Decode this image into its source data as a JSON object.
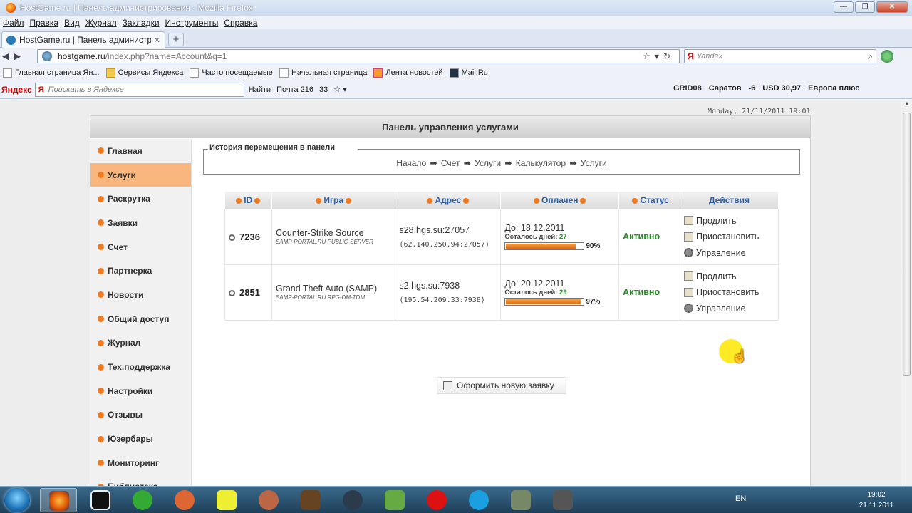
{
  "window": {
    "title": "HostGame.ru | Панель администрирования - Mozilla Firefox"
  },
  "menu": [
    "Файл",
    "Правка",
    "Вид",
    "Журнал",
    "Закладки",
    "Инструменты",
    "Справка"
  ],
  "tab": {
    "label": "HostGame.ru | Панель администров..."
  },
  "address": {
    "host": "hostgame.ru",
    "path": "/index.php?name=Account&q=1"
  },
  "search": {
    "placeholder": "Yandex"
  },
  "bookmarks": [
    "Главная страница Ян...",
    "Сервисы Яндекса",
    "Часто посещаемые",
    "Начальная страница",
    "Лента новостей",
    "Mail.Ru"
  ],
  "yandex_bar": {
    "logo": "Яндекс",
    "placeholder": "Поискать в Яндексе",
    "find": "Найти",
    "mail": "Почта 216",
    "count": "33",
    "weather": "GRID08",
    "city": "Саратов",
    "temp": "-6",
    "usd": "USD 30,97",
    "radio": "Европа плюс"
  },
  "page": {
    "date": "Monday, 21/11/2011 19:01",
    "panel_title": "Панель управления услугами",
    "history_legend": "История перемещения в панели",
    "history_path": "Начало ➡ Счет ➡ Услуги ➡ Калькулятор ➡ Услуги",
    "new_request": "Оформить новую заявку"
  },
  "sidebar": [
    {
      "label": "Главная",
      "active": false
    },
    {
      "label": "Услуги",
      "active": true
    },
    {
      "label": "Раскрутка",
      "active": false
    },
    {
      "label": "Заявки",
      "active": false
    },
    {
      "label": "Счет",
      "active": false
    },
    {
      "label": "Партнерка",
      "active": false
    },
    {
      "label": "Новости",
      "active": false
    },
    {
      "label": "Общий доступ",
      "active": false
    },
    {
      "label": "Журнал",
      "active": false
    },
    {
      "label": "Тех.поддержка",
      "active": false
    },
    {
      "label": "Настройки",
      "active": false
    },
    {
      "label": "Отзывы",
      "active": false
    },
    {
      "label": "Юзербары",
      "active": false
    },
    {
      "label": "Мониторинг",
      "active": false
    },
    {
      "label": "Библиотека",
      "active": false
    }
  ],
  "table": {
    "headers": [
      "ID",
      "Игра",
      "Адрес",
      "Оплачен",
      "Статус",
      "Действия"
    ],
    "rows": [
      {
        "id": "7236",
        "game": "Counter-Strike Source",
        "server": "SAMP-PORTAL.RU PUBLIC-SERVER",
        "address": "s28.hgs.su:27057",
        "ip": "(62.140.250.94:27057)",
        "paid_until": "До: 18.12.2011",
        "days_left_label": "Осталось дней:",
        "days_left": "27",
        "percent": "90%",
        "percent_value": 90,
        "status": "Активно",
        "actions": [
          "Продлить",
          "Приостановить",
          "Управление"
        ]
      },
      {
        "id": "2851",
        "game": "Grand Theft Auto (SAMP)",
        "server": "SAMP-PORTAL.RU RPG-DM-TDM",
        "address": "s2.hgs.su:7938",
        "ip": "(195.54.209.33:7938)",
        "paid_until": "До: 20.12.2011",
        "days_left_label": "Осталось дней:",
        "days_left": "29",
        "percent": "97%",
        "percent_value": 97,
        "status": "Активно",
        "actions": [
          "Продлить",
          "Приостановить",
          "Управление"
        ]
      }
    ]
  },
  "taskbar": {
    "lang": "EN",
    "time": "19:02",
    "date": "21.11.2011"
  },
  "colors": {
    "accent": "#f07a20",
    "active_item": "#f9b77e",
    "status": "#2a8a2a",
    "header_text": "#2d5fa8"
  }
}
